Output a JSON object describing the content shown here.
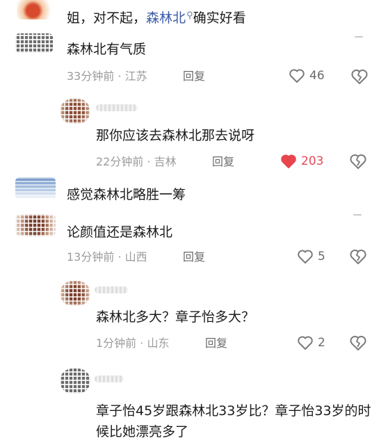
{
  "comments": [
    {
      "text_prefix": "姐，对不起，",
      "mention": "森林北",
      "text_suffix": "确实好看"
    },
    {
      "text": "森林北有气质",
      "time": "33分钟前",
      "location": "江苏",
      "reply_label": "回复",
      "likes": "46"
    },
    {
      "text": "那你应该去森林北那去说呀",
      "time": "22分钟前",
      "location": "吉林",
      "reply_label": "回复",
      "likes": "203",
      "liked": true
    },
    {
      "text": "感觉森林北略胜一筹"
    },
    {
      "text": "论颜值还是森林北",
      "time": "13分钟前",
      "location": "山西",
      "reply_label": "回复",
      "likes": "5"
    },
    {
      "text": "森林北多大？章子怡多大？",
      "time": "1分钟前",
      "location": "山东",
      "reply_label": "回复",
      "likes": "2"
    },
    {
      "text": "章子怡45岁跟森林北33岁比？章子怡33岁的时候比她漂亮多了"
    }
  ],
  "meta_separator": "·",
  "colors": {
    "liked_heart": "#e8454f",
    "mention": "#3a5aa6",
    "meta": "#9b9b9b"
  },
  "icons": [
    "heart-icon",
    "heart-filled-icon",
    "broken-heart-icon",
    "search-icon"
  ]
}
